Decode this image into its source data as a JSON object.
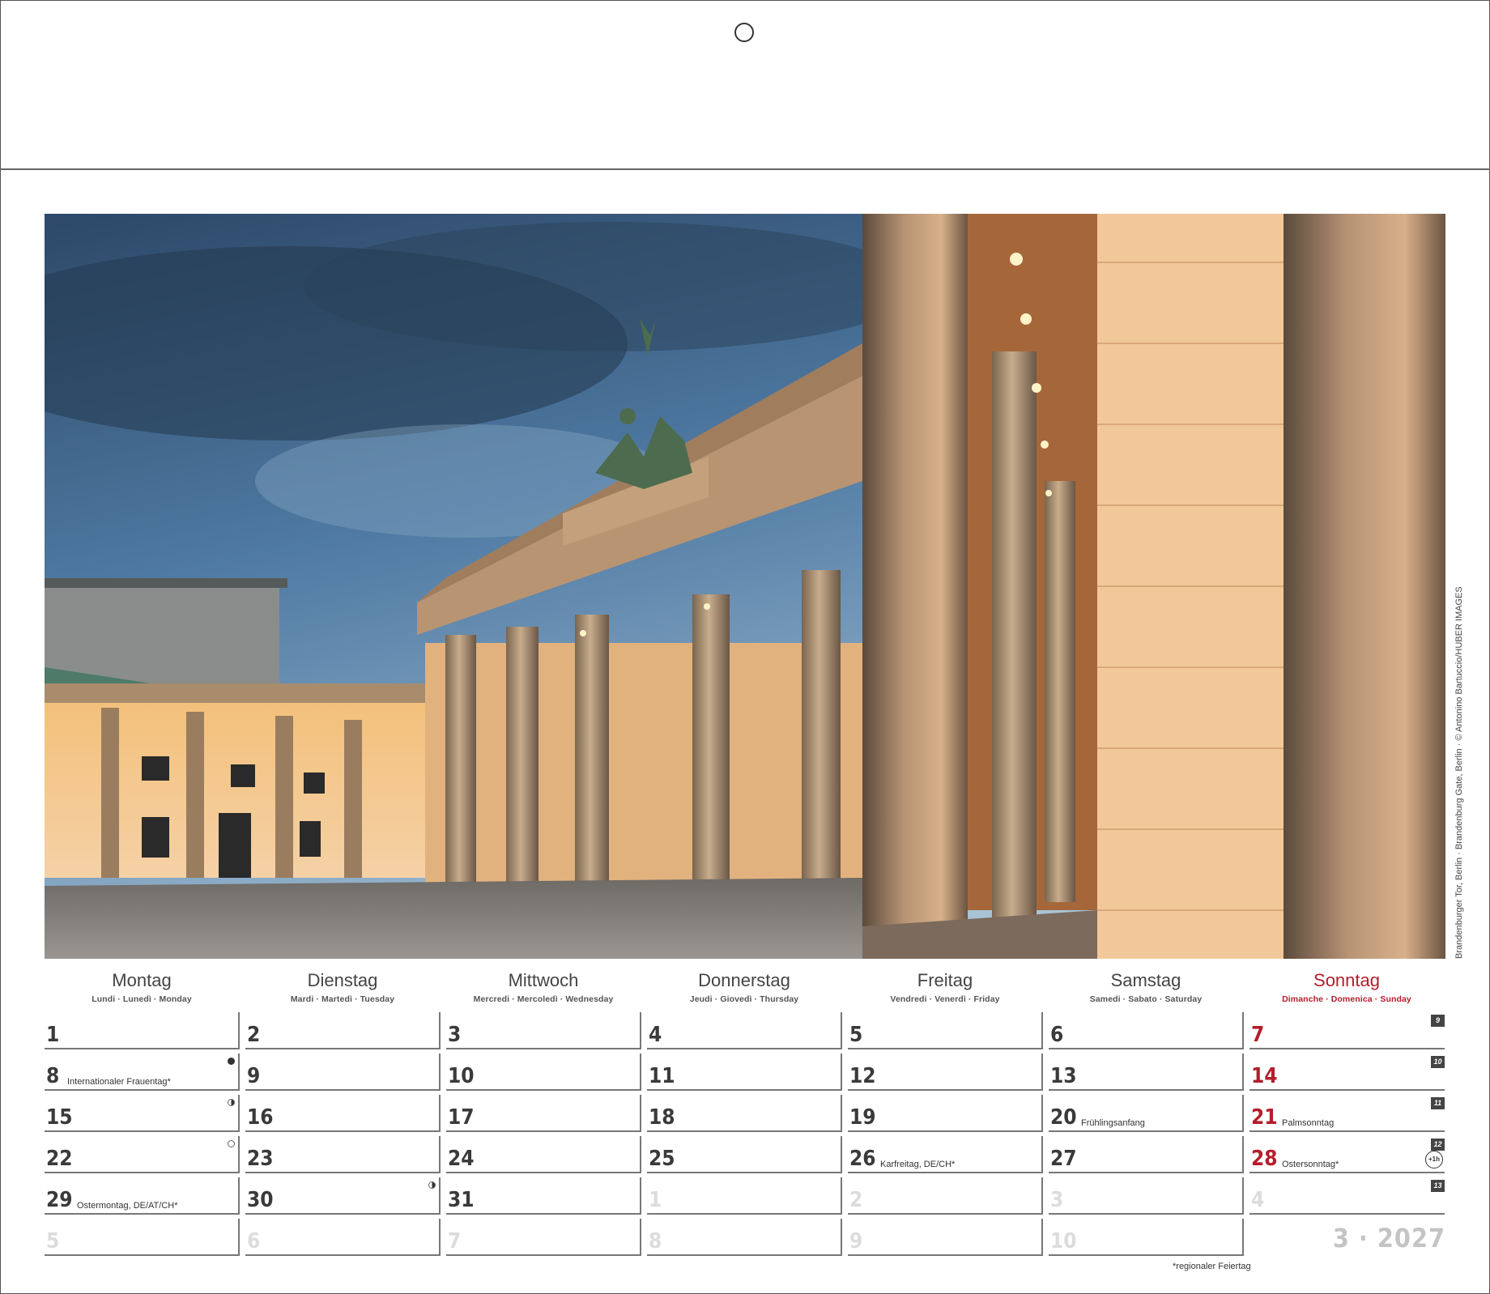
{
  "photo_credit": "Brandenburger Tor, Berlin · Brandenburg Gate, Berlin · © Antonino Bartuccio/HUBER IMAGES",
  "weekdays": [
    {
      "name": "Montag",
      "sub": "Lundi · Lunedì · Monday"
    },
    {
      "name": "Dienstag",
      "sub": "Mardi · Martedì · Tuesday"
    },
    {
      "name": "Mittwoch",
      "sub": "Mercredi · Mercoledì · Wednesday"
    },
    {
      "name": "Donnerstag",
      "sub": "Jeudi · Giovedì · Thursday"
    },
    {
      "name": "Freitag",
      "sub": "Vendredi · Venerdì · Friday"
    },
    {
      "name": "Samstag",
      "sub": "Samedi · Sabato · Saturday"
    },
    {
      "name": "Sonntag",
      "sub": "Dimanche · Domenica · Sunday"
    }
  ],
  "weeks": [
    {
      "kw": "9",
      "days": [
        {
          "day": "1"
        },
        {
          "day": "2"
        },
        {
          "day": "3"
        },
        {
          "day": "4"
        },
        {
          "day": "5"
        },
        {
          "day": "6"
        },
        {
          "day": "7"
        }
      ]
    },
    {
      "kw": "10",
      "days": [
        {
          "day": "8",
          "note": "Internationaler Frauentag*",
          "moon": "full"
        },
        {
          "day": "9"
        },
        {
          "day": "10"
        },
        {
          "day": "11"
        },
        {
          "day": "12"
        },
        {
          "day": "13"
        },
        {
          "day": "14"
        }
      ]
    },
    {
      "kw": "11",
      "days": [
        {
          "day": "15",
          "moon": "half"
        },
        {
          "day": "16"
        },
        {
          "day": "17"
        },
        {
          "day": "18"
        },
        {
          "day": "19"
        },
        {
          "day": "20",
          "note": "Frühlingsanfang"
        },
        {
          "day": "21",
          "note": "Palmsonntag"
        }
      ]
    },
    {
      "kw": "12",
      "days": [
        {
          "day": "22",
          "moon": "new"
        },
        {
          "day": "23"
        },
        {
          "day": "24"
        },
        {
          "day": "25"
        },
        {
          "day": "26",
          "note": "Karfreitag, DE/CH*"
        },
        {
          "day": "27"
        },
        {
          "day": "28",
          "note": "Ostersonntag*",
          "dst": "+1h"
        }
      ]
    },
    {
      "kw": "13",
      "days": [
        {
          "day": "29",
          "note": "Ostermontag, DE/AT/CH*"
        },
        {
          "day": "30",
          "moon": "half"
        },
        {
          "day": "31"
        },
        {
          "day": "1",
          "muted": true
        },
        {
          "day": "2",
          "muted": true
        },
        {
          "day": "3",
          "muted": true
        },
        {
          "day": "4",
          "muted": true
        }
      ]
    },
    {
      "kw": "",
      "days": [
        {
          "day": "5",
          "muted": true
        },
        {
          "day": "6",
          "muted": true
        },
        {
          "day": "7",
          "muted": true
        },
        {
          "day": "8",
          "muted": true
        },
        {
          "day": "9",
          "muted": true
        },
        {
          "day": "10",
          "muted": true
        }
      ]
    }
  ],
  "month_year": "3 · 2027",
  "footnote": "*regionaler Feiertag"
}
